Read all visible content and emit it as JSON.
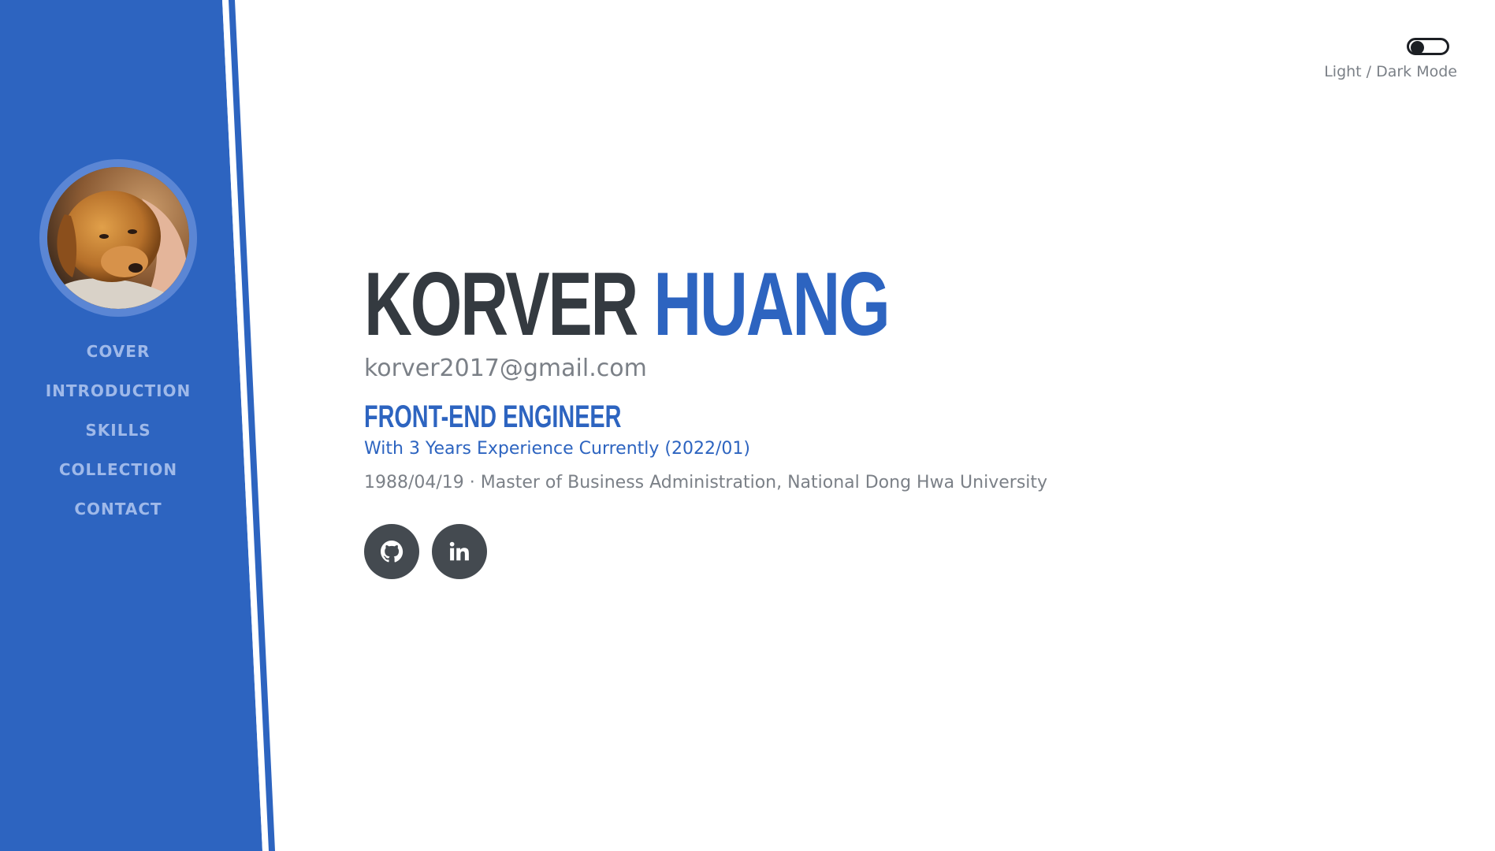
{
  "theme": {
    "accent": "#2d64c0",
    "sidebar_bg": "#2d64c0",
    "nav_text": "#9fb9e9",
    "dark_text": "#343a40",
    "muted_text": "#7b8087"
  },
  "sidebar": {
    "avatar_alt": "puppy avatar",
    "nav": [
      {
        "label": "COVER"
      },
      {
        "label": "INTRODUCTION"
      },
      {
        "label": "SKILLS"
      },
      {
        "label": "COLLECTION"
      },
      {
        "label": "CONTACT"
      }
    ]
  },
  "theme_toggle": {
    "label": "Light / Dark Mode",
    "state": "light"
  },
  "profile": {
    "first_name": "KORVER",
    "last_name": "HUANG",
    "email": "korver2017@gmail.com",
    "title": "FRONT-END ENGINEER",
    "experience": "With 3 Years Experience Currently (2022/01)",
    "bio": "1988/04/19 · Master of Business Administration, National Dong Hwa University"
  },
  "social": [
    {
      "icon": "github-icon"
    },
    {
      "icon": "linkedin-icon"
    }
  ]
}
